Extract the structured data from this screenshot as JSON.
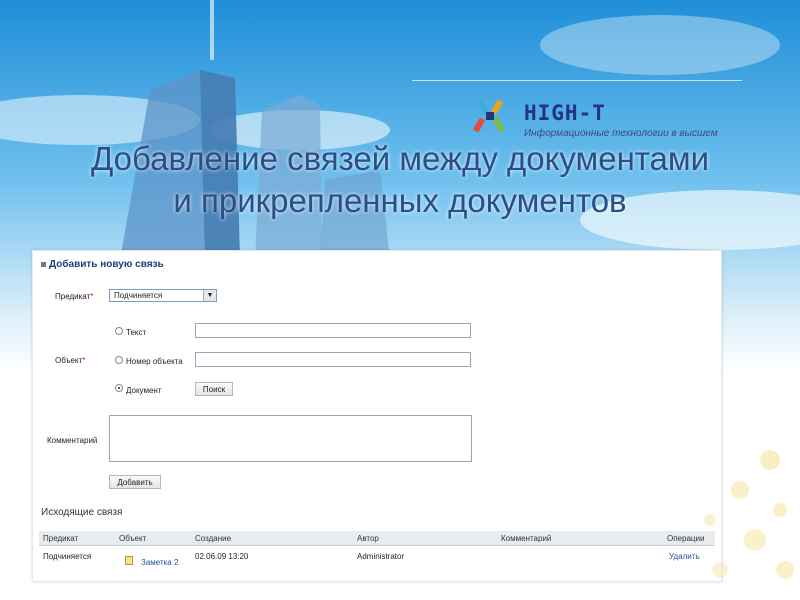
{
  "logo": {
    "name": "HIGH-T",
    "tagline": "Информационные технологии в высшем"
  },
  "slide": {
    "title_line1": "Добавление связей между документами",
    "title_line2": "и прикрепленных  документов"
  },
  "form": {
    "section_title": "Добавить новую связь",
    "predicate_label": "Предикат",
    "required_mark": "*",
    "predicate_value": "Подчиняется",
    "object_label": "Объект",
    "radio_text": "Текст",
    "radio_object_number": "Номер объекта",
    "radio_document": "Документ",
    "search_button": "Поиск",
    "comment_label": "Комментарий",
    "add_button": "Добавить"
  },
  "outgoing": {
    "title": "Исходящие связя",
    "columns": [
      "Предикат",
      "Объект",
      "Создание",
      "Автор",
      "Комментарий",
      "Операции"
    ],
    "rows": [
      {
        "predicate": "Подчиняется",
        "object": "Заметка 2",
        "created": "02.06.09 13:20",
        "author": "Administrator",
        "comment": "",
        "operation": "Удалить"
      }
    ]
  },
  "colors": {
    "title": "#2b4e86",
    "logo": "#26337e",
    "link": "#1f4fa3"
  }
}
